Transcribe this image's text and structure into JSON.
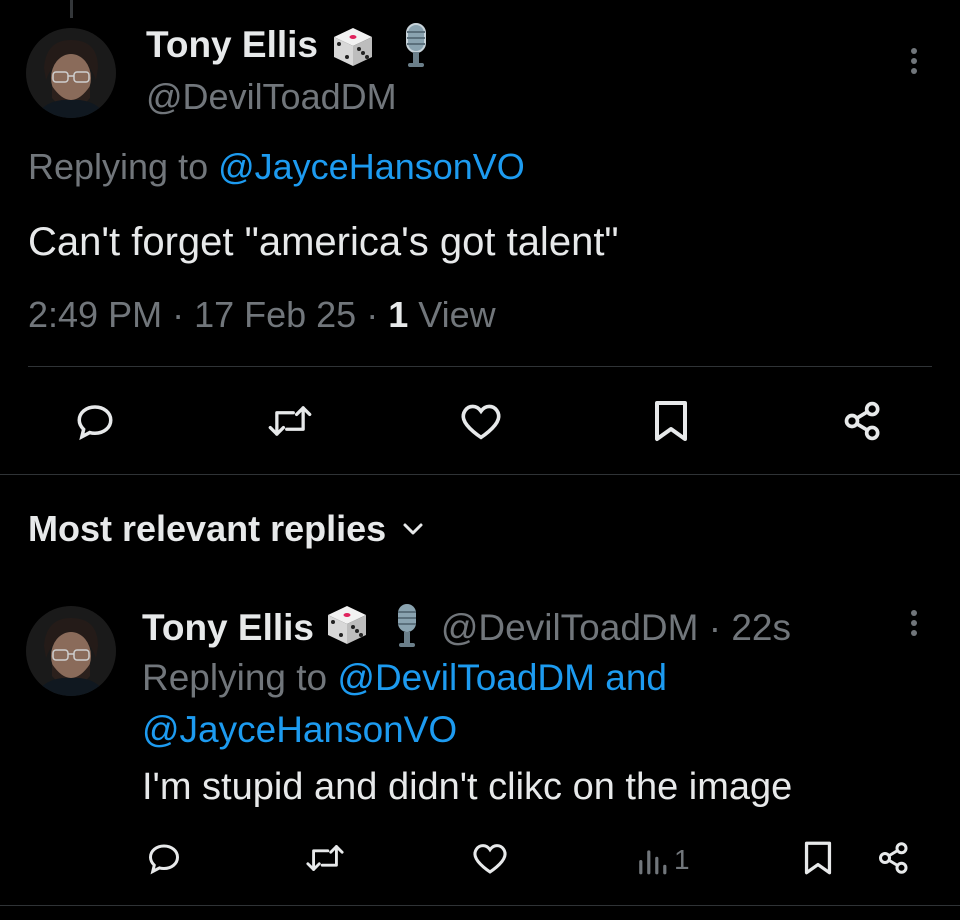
{
  "main_tweet": {
    "author_name": "Tony Ellis",
    "author_handle": "@DevilToadDM",
    "replying_prefix": "Replying to ",
    "replying_to": "@JayceHansonVO",
    "text": "Can't forget \"america's got talent\"",
    "time": "2:49 PM",
    "sep1": " · ",
    "date": "17 Feb 25",
    "sep2": " · ",
    "views_count": "1",
    "views_label": " View"
  },
  "replies_section": {
    "title": "Most relevant replies"
  },
  "reply": {
    "author_name": "Tony Ellis",
    "author_handle": "@DevilToadDM",
    "sep": " · ",
    "age": "22s",
    "replying_prefix": "Replying to ",
    "replying_to_1": "@DevilToadDM",
    "replying_and": " and",
    "replying_to_2": "@JayceHansonVO",
    "text": "I'm stupid and didn't clikc on the image",
    "view_count": "1"
  },
  "icons": {
    "name_badges": [
      "die-icon",
      "microphone-icon"
    ],
    "actions": [
      "reply-icon",
      "retweet-icon",
      "like-icon",
      "bookmark-icon",
      "share-icon"
    ],
    "reply_actions": [
      "reply-icon",
      "retweet-icon",
      "like-icon",
      "views-icon",
      "bookmark-icon",
      "share-icon"
    ]
  },
  "colors": {
    "background": "#000000",
    "text": "#e7e9ea",
    "secondary": "#71767b",
    "link": "#1d9bf0",
    "divider": "#2f3336"
  }
}
